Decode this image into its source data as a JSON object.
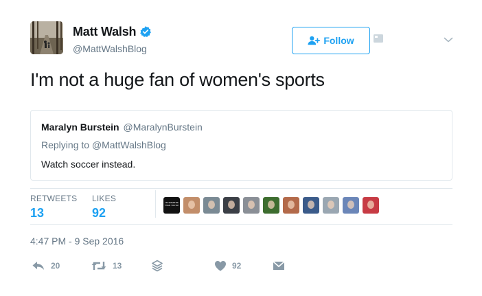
{
  "header": {
    "display_name": "Matt Walsh",
    "handle": "@MattWalshBlog",
    "verified": true,
    "follow_label": "Follow"
  },
  "tweet": {
    "text": "I'm not a huge fan of women's sports"
  },
  "quoted_tweet": {
    "author_name": "Maralyn Burstein",
    "author_handle": "@MaralynBurstein",
    "replying_prefix": "Replying to",
    "replying_to": "@MattWalshBlog",
    "text": "Watch soccer instead."
  },
  "stats": {
    "retweets_label": "RETWEETS",
    "retweets_count": "13",
    "likes_label": "LIKES",
    "likes_count": "92",
    "liker_avatars": [
      {
        "color": "#111111",
        "label": "I'M SMARTER THAN YOU'RE"
      },
      {
        "color": "#c28e6a"
      },
      {
        "color": "#7a8a94"
      },
      {
        "color": "#3b3f46"
      },
      {
        "color": "#8a8f96"
      },
      {
        "color": "#3d6d2f"
      },
      {
        "color": "#b36a4a"
      },
      {
        "color": "#3b5b8a"
      },
      {
        "color": "#9aa7b2"
      },
      {
        "color": "#6b86b8"
      },
      {
        "color": "#c73b44"
      }
    ]
  },
  "timestamp": "4:47 PM - 9 Sep 2016",
  "actions": {
    "reply_count": "20",
    "retweet_count": "13",
    "like_count": "92"
  },
  "colors": {
    "accent": "#1da1f2",
    "muted": "#657786",
    "icon": "#8899a6",
    "border": "#e1e8ed"
  }
}
